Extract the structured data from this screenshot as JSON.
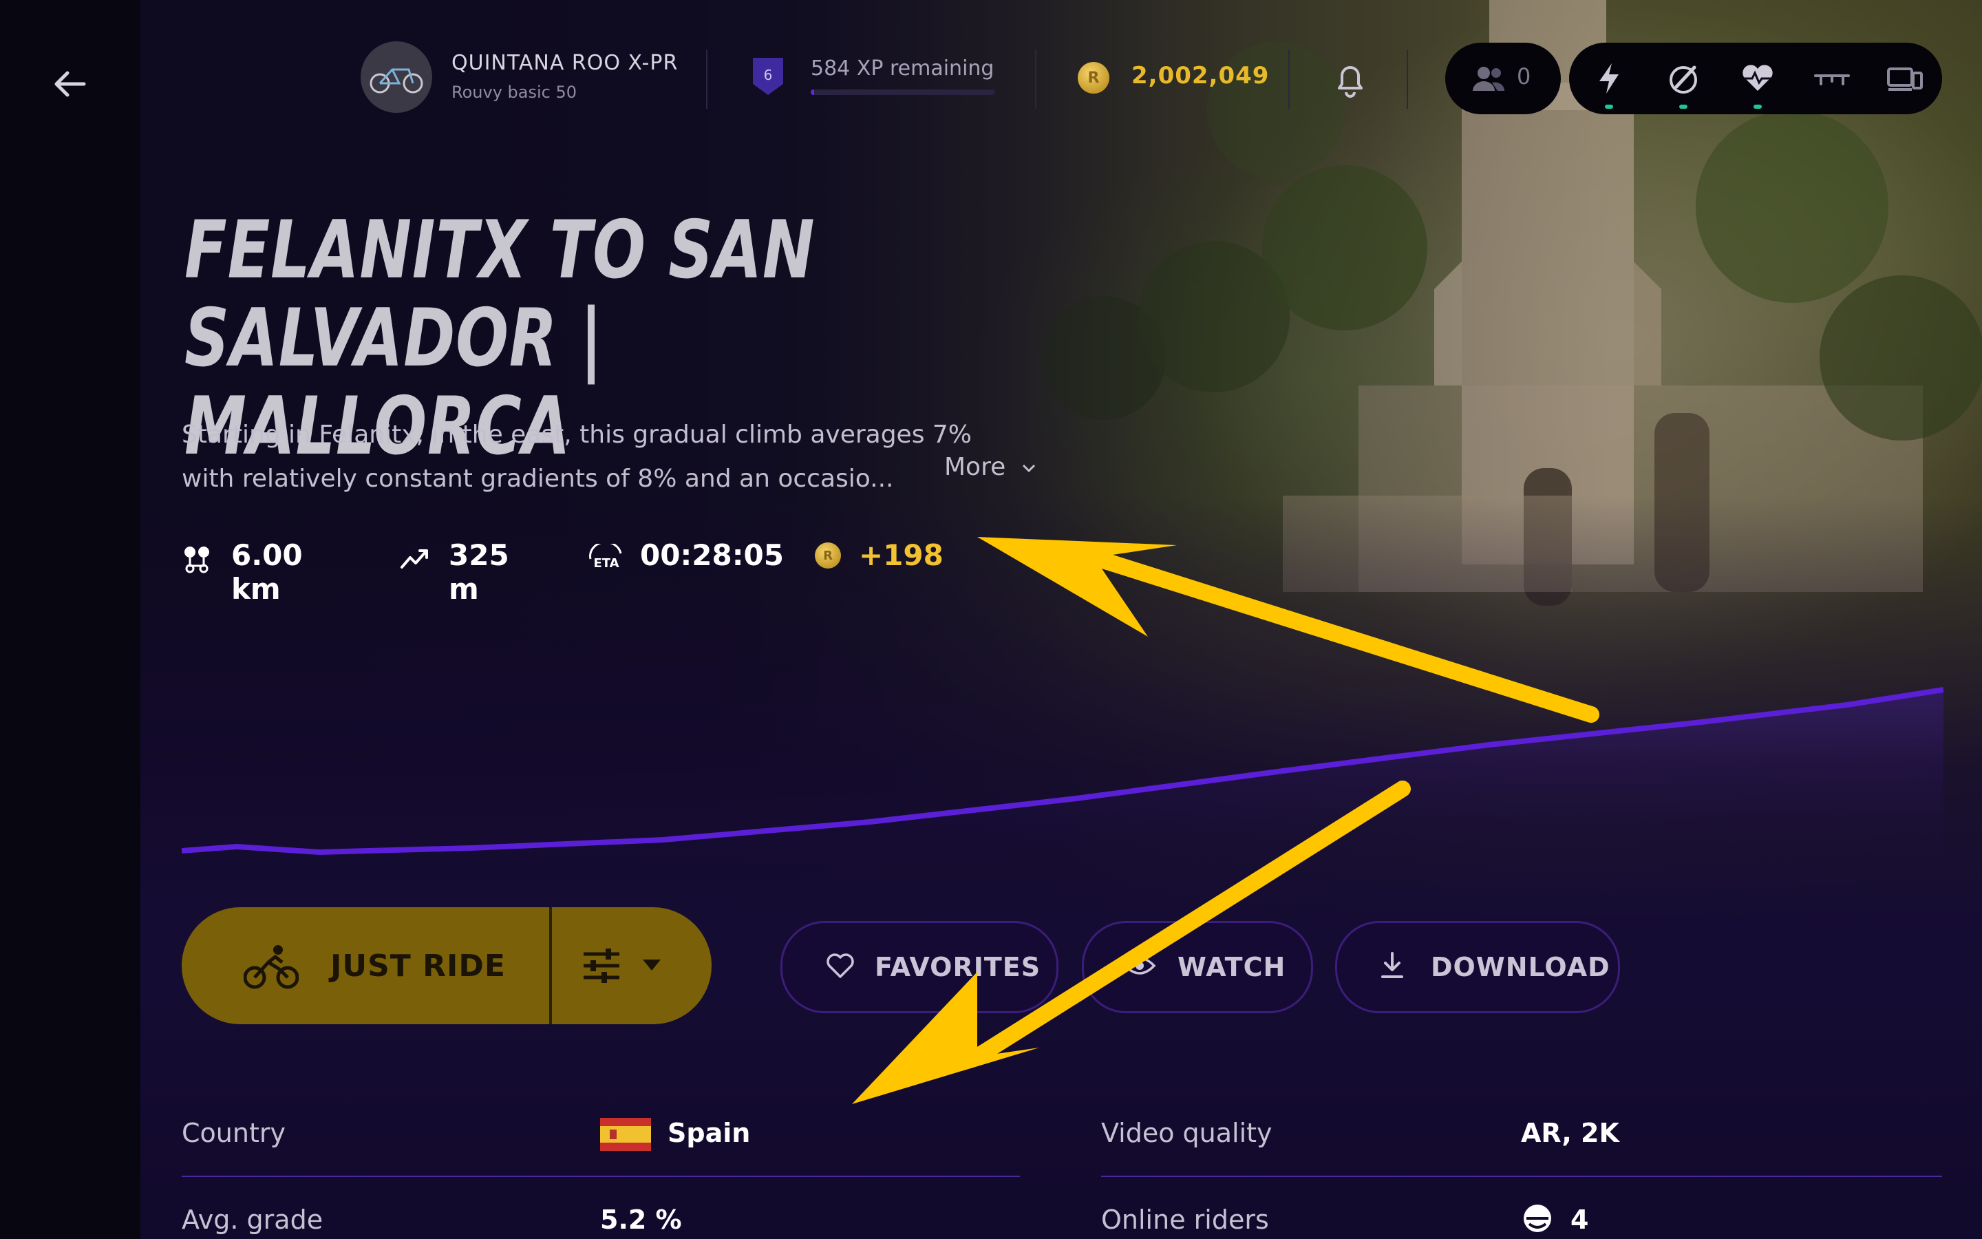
{
  "nav": {
    "back_label": "back"
  },
  "bike": {
    "name": "QUINTANA ROO X-PR",
    "subtitle": "Rouvy basic 50"
  },
  "level": {
    "number": "6",
    "xp_remaining": "584 XP remaining",
    "progress": 0.02
  },
  "coins": {
    "total": "2,002,049",
    "symbol": "R"
  },
  "friends": {
    "count": "0"
  },
  "devices": [
    "power-icon",
    "cadence-icon",
    "heart-rate-icon",
    "trainer-icon",
    "screen-icon"
  ],
  "route": {
    "title": "FELANITX TO SAN SALVADOR | MALLORCA",
    "description": "Starting in Felanitx, in the east, this gradual climb averages 7% with relatively constant gradients of 8% and an occasio...",
    "more_label": "More",
    "stats": {
      "distance": "6.00 km",
      "elevation": "325 m",
      "eta": "00:28:05",
      "coins": "+198"
    }
  },
  "actions": {
    "just_ride": "JUST RIDE",
    "favorites": "FAVORITES",
    "watch": "WATCH",
    "download": "DOWNLOAD"
  },
  "info": {
    "country_label": "Country",
    "country_value": "Spain",
    "video_quality_label": "Video quality",
    "video_quality_value": "AR, 2K",
    "avg_grade_label": "Avg. grade",
    "avg_grade_value": "5.2 %",
    "online_riders_label": "Online riders",
    "online_riders_value": "4"
  },
  "colors": {
    "accent_gold": "#7a6009",
    "coin_gold": "#f2c230",
    "purple": "#5a1fd6",
    "annotation_yellow": "#ffc600"
  }
}
